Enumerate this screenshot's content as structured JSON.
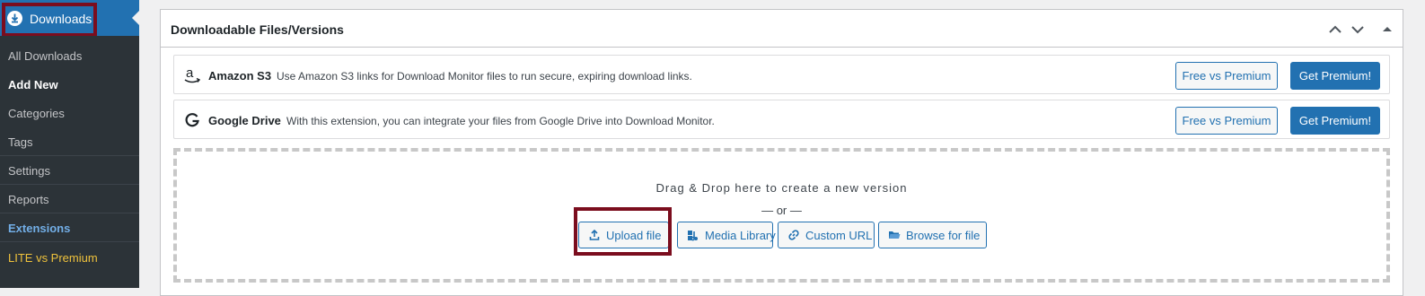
{
  "sidebar": {
    "menu_title": "Downloads",
    "items": [
      {
        "label": "All Downloads"
      },
      {
        "label": "Add New"
      },
      {
        "label": "Categories"
      },
      {
        "label": "Tags"
      },
      {
        "label": "Settings"
      },
      {
        "label": "Reports"
      },
      {
        "label": "Extensions"
      },
      {
        "label": "LITE vs Premium"
      }
    ]
  },
  "panel": {
    "title": "Downloadable Files/Versions",
    "controls": [
      "chevron-up-icon",
      "chevron-down-icon",
      "triangle-up-icon"
    ]
  },
  "extensions": [
    {
      "name": "Amazon S3",
      "description": "Use Amazon S3 links for Download Monitor files to run secure, expiring download links.",
      "compare_label": "Free vs Premium",
      "cta_label": "Get Premium!",
      "icon": "amazon-icon"
    },
    {
      "name": "Google Drive",
      "description": "With this extension, you can integrate your files from Google Drive into Download Monitor.",
      "compare_label": "Free vs Premium",
      "cta_label": "Get Premium!",
      "icon": "google-icon"
    }
  ],
  "dropzone": {
    "text": "Drag & Drop here to create a new version",
    "or_text": "— or —",
    "buttons": [
      {
        "label": "Upload file",
        "icon": "upload-icon"
      },
      {
        "label": "Media Library",
        "icon": "media-library-icon"
      },
      {
        "label": "Custom URL",
        "icon": "link-icon"
      },
      {
        "label": "Browse for file",
        "icon": "folder-icon"
      }
    ]
  },
  "colors": {
    "primary": "#2271b1",
    "sidebar_bg": "#1d2327",
    "highlight_border": "#7b0d1e",
    "lite_text": "#f0c33c"
  }
}
